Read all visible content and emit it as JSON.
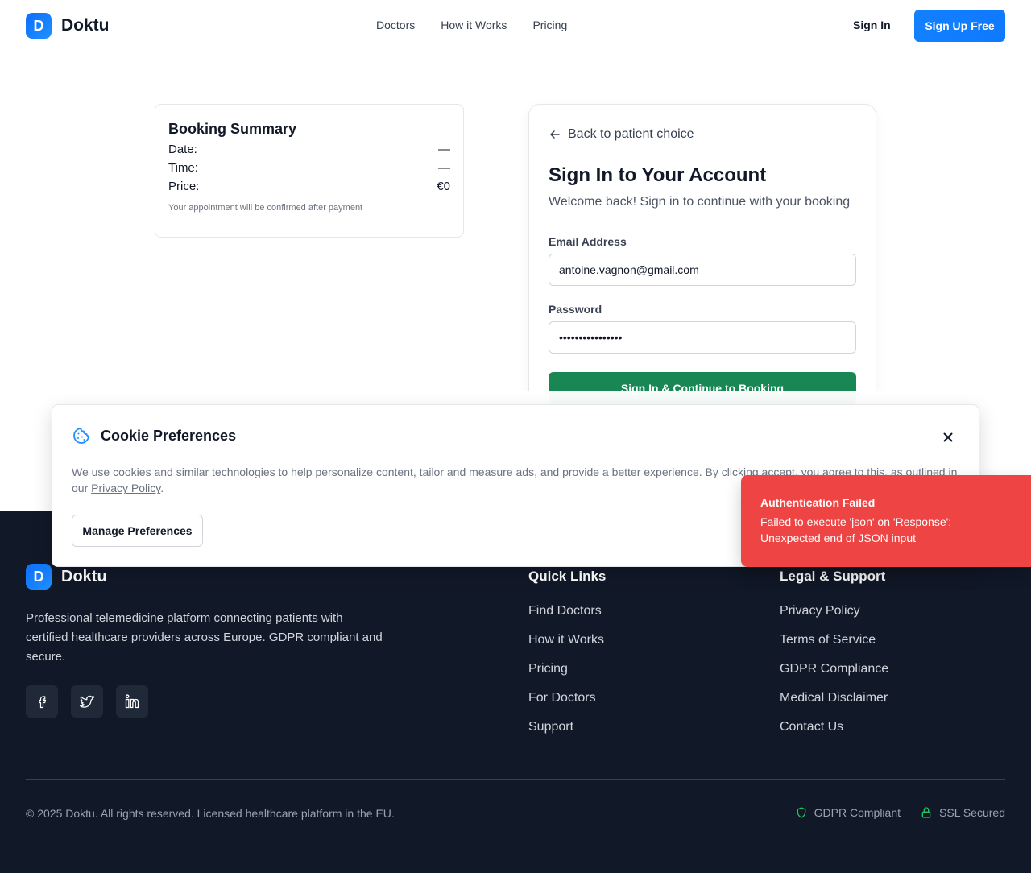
{
  "header": {
    "logo_letter": "D",
    "brand": "Doktu",
    "nav": [
      "Doctors",
      "How it Works",
      "Pricing"
    ],
    "sign_in": "Sign In",
    "sign_up": "Sign Up Free"
  },
  "summary": {
    "title": "Booking Summary",
    "rows": [
      {
        "label": "Date:",
        "value": "—"
      },
      {
        "label": "Time:",
        "value": "—"
      },
      {
        "label": "Price:",
        "value": "€0"
      }
    ],
    "note": "Your appointment will be confirmed after payment"
  },
  "signin": {
    "back": "Back to patient choice",
    "title": "Sign In to Your Account",
    "subtitle": "Welcome back! Sign in to continue with your booking",
    "email_label": "Email Address",
    "email_value": "antoine.vagnon@gmail.com",
    "password_label": "Password",
    "password_value": "••••••••••••••••",
    "submit": "Sign In & Continue to Booking"
  },
  "cookie": {
    "title": "Cookie Preferences",
    "text": "We use cookies and similar technologies to help personalize content, tailor and measure ads, and provide a better experience. By clicking accept, you agree to this, as outlined in our",
    "link": "Privacy Policy",
    "manage": "Manage Preferences"
  },
  "toast": {
    "title": "Authentication Failed",
    "message": "Failed to execute 'json' on 'Response': Unexpected end of JSON input",
    "color": "#ef4444"
  },
  "footer": {
    "brand": "Doktu",
    "description": "Professional telemedicine platform connecting patients with certified healthcare providers across Europe. GDPR compliant and secure.",
    "socials": [
      "facebook-icon",
      "twitter-icon",
      "linkedin-icon"
    ],
    "quick_links": {
      "title": "Quick Links",
      "items": [
        "Find Doctors",
        "How it Works",
        "Pricing",
        "For Doctors",
        "Support"
      ]
    },
    "legal": {
      "title": "Legal & Support",
      "items": [
        "Privacy Policy",
        "Terms of Service",
        "GDPR Compliance",
        "Medical Disclaimer",
        "Contact Us"
      ]
    },
    "copyright": "© 2025 Doktu. All rights reserved. Licensed healthcare platform in the EU.",
    "badges": [
      "GDPR Compliant",
      "SSL Secured"
    ]
  }
}
